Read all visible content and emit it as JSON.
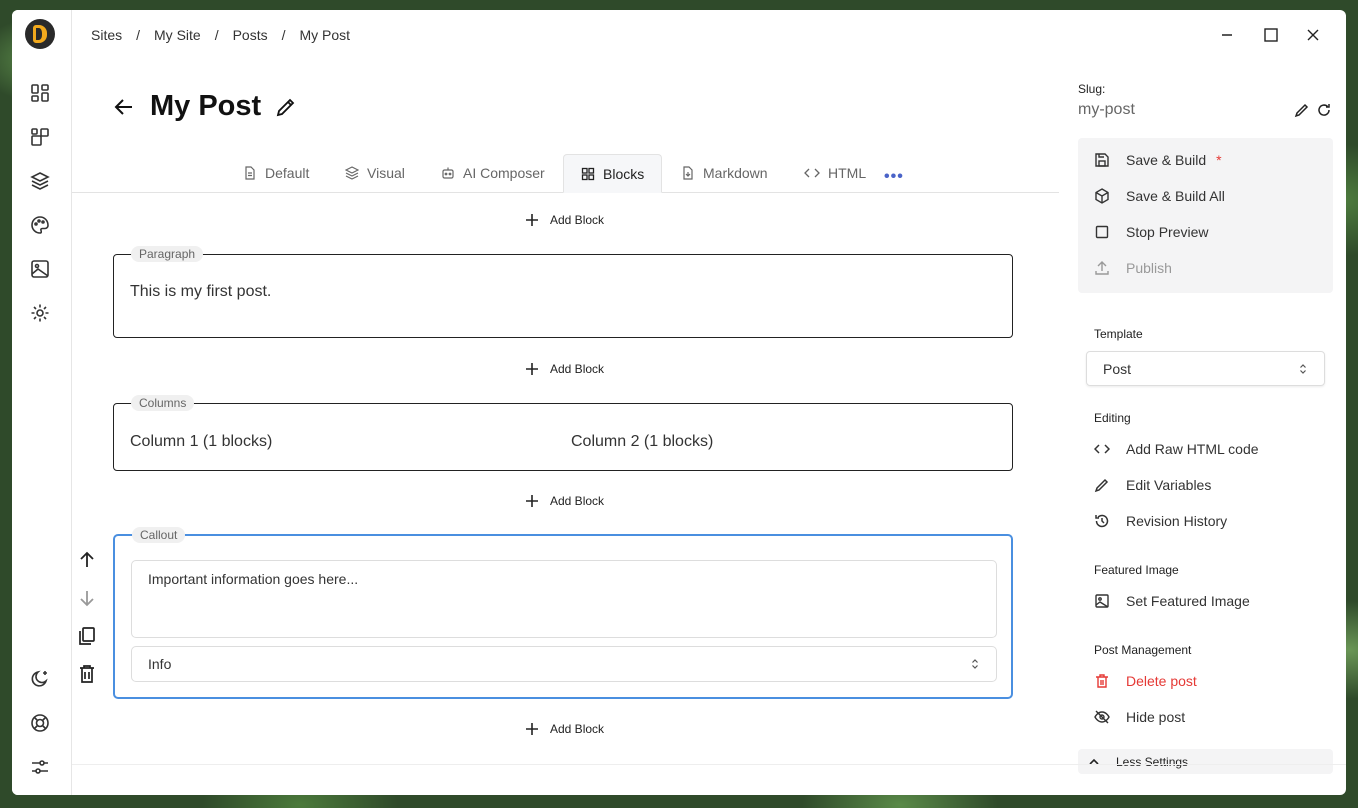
{
  "breadcrumb": [
    "Sites",
    "My Site",
    "Posts",
    "My Post"
  ],
  "breadcrumb_separator": "/",
  "page": {
    "title": "My Post"
  },
  "tabs": [
    {
      "label": "Default",
      "icon": "file-icon"
    },
    {
      "label": "Visual",
      "icon": "layers-icon"
    },
    {
      "label": "AI Composer",
      "icon": "robot-icon"
    },
    {
      "label": "Blocks",
      "icon": "grid-icon",
      "active": true
    },
    {
      "label": "Markdown",
      "icon": "markdown-icon"
    },
    {
      "label": "HTML",
      "icon": "code-icon"
    }
  ],
  "add_block_label": "Add Block",
  "blocks": {
    "paragraph": {
      "label": "Paragraph",
      "text": "This is my first post."
    },
    "columns": {
      "label": "Columns",
      "col1": "Column 1 (1 blocks)",
      "col2": "Column 2 (1 blocks)"
    },
    "callout": {
      "label": "Callout",
      "text": "Important information goes here...",
      "type": "Info"
    }
  },
  "sidebar": {
    "slug_label": "Slug:",
    "slug_value": "my-post",
    "actions": {
      "save_build": "Save & Build",
      "save_build_asterisk": "*",
      "save_build_all": "Save & Build All",
      "stop_preview": "Stop Preview",
      "publish": "Publish"
    },
    "template_title": "Template",
    "template_value": "Post",
    "editing_title": "Editing",
    "editing": {
      "raw_html": "Add Raw HTML code",
      "edit_variables": "Edit Variables",
      "revision_history": "Revision History"
    },
    "featured_title": "Featured Image",
    "set_featured": "Set Featured Image",
    "management_title": "Post Management",
    "delete_post": "Delete post",
    "hide_post": "Hide post",
    "less_settings": "Less Settings"
  },
  "colors": {
    "accent": "#4a8fe0",
    "danger": "#e53935",
    "logo": "#f2a91d"
  }
}
